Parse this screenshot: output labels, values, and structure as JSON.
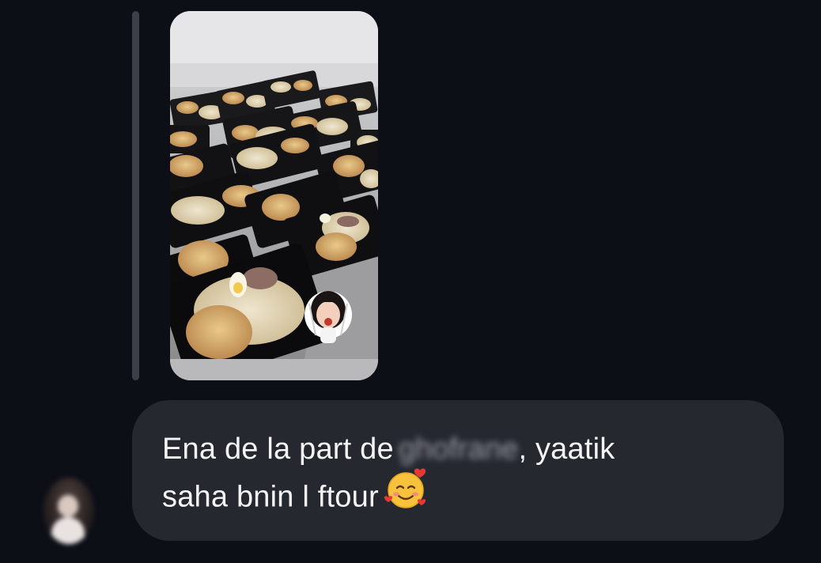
{
  "chat": {
    "story_reply": {
      "image_description_icon": "food-tray-photo",
      "sticker_icon": "girl-eating-sticker"
    },
    "message": {
      "line1_before": "Ena de la part de",
      "redacted_name": "ghofrane",
      "line1_after": ",  yaatik",
      "line2": "saha bnin l ftour",
      "emoji_icon": "smiling-face-with-hearts-icon"
    },
    "sender": {
      "avatar_icon": "user-avatar"
    }
  },
  "colors": {
    "background": "#0d0f17",
    "bubble": "#262830",
    "reply_bar": "#3c3f47",
    "text": "#f4f4f6"
  }
}
